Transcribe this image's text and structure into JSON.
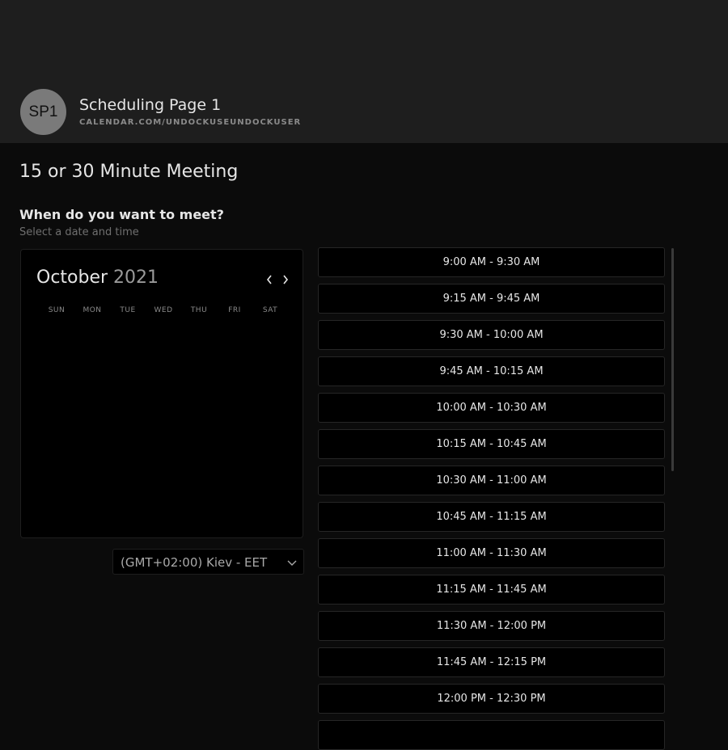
{
  "header": {
    "avatar_initials": "SP1",
    "page_title": "Scheduling Page 1",
    "page_url": "CALENDAR.COM/UNDOCKUSEUNDOCKUSER"
  },
  "meeting": {
    "title": "15 or 30 Minute Meeting",
    "question": "When do you want to meet?",
    "instruction": "Select a date and time"
  },
  "calendar": {
    "month": "October",
    "year": "2021",
    "prev_icon": "chevron-left-icon",
    "next_icon": "chevron-right-icon",
    "weekdays": [
      "SUN",
      "MON",
      "TUE",
      "WED",
      "THU",
      "FRI",
      "SAT"
    ]
  },
  "timezone": {
    "selected": "(GMT+02:00) Kiev - EET",
    "icon": "chevron-down-icon"
  },
  "time_slots": [
    "9:00 AM - 9:30 AM",
    "9:15 AM - 9:45 AM",
    "9:30 AM - 10:00 AM",
    "9:45 AM - 10:15 AM",
    "10:00 AM - 10:30 AM",
    "10:15 AM - 10:45 AM",
    "10:30 AM - 11:00 AM",
    "10:45 AM - 11:15 AM",
    "11:00 AM - 11:30 AM",
    "11:15 AM - 11:45 AM",
    "11:30 AM - 12:00 PM",
    "11:45 AM - 12:15 PM",
    "12:00 PM - 12:30 PM"
  ],
  "colors": {
    "header_bg": "#1e1e1e",
    "page_bg": "#0b0b0b",
    "panel_bg": "#000000",
    "text": "#e6e6e6",
    "muted_text": "#6f6f6f"
  }
}
